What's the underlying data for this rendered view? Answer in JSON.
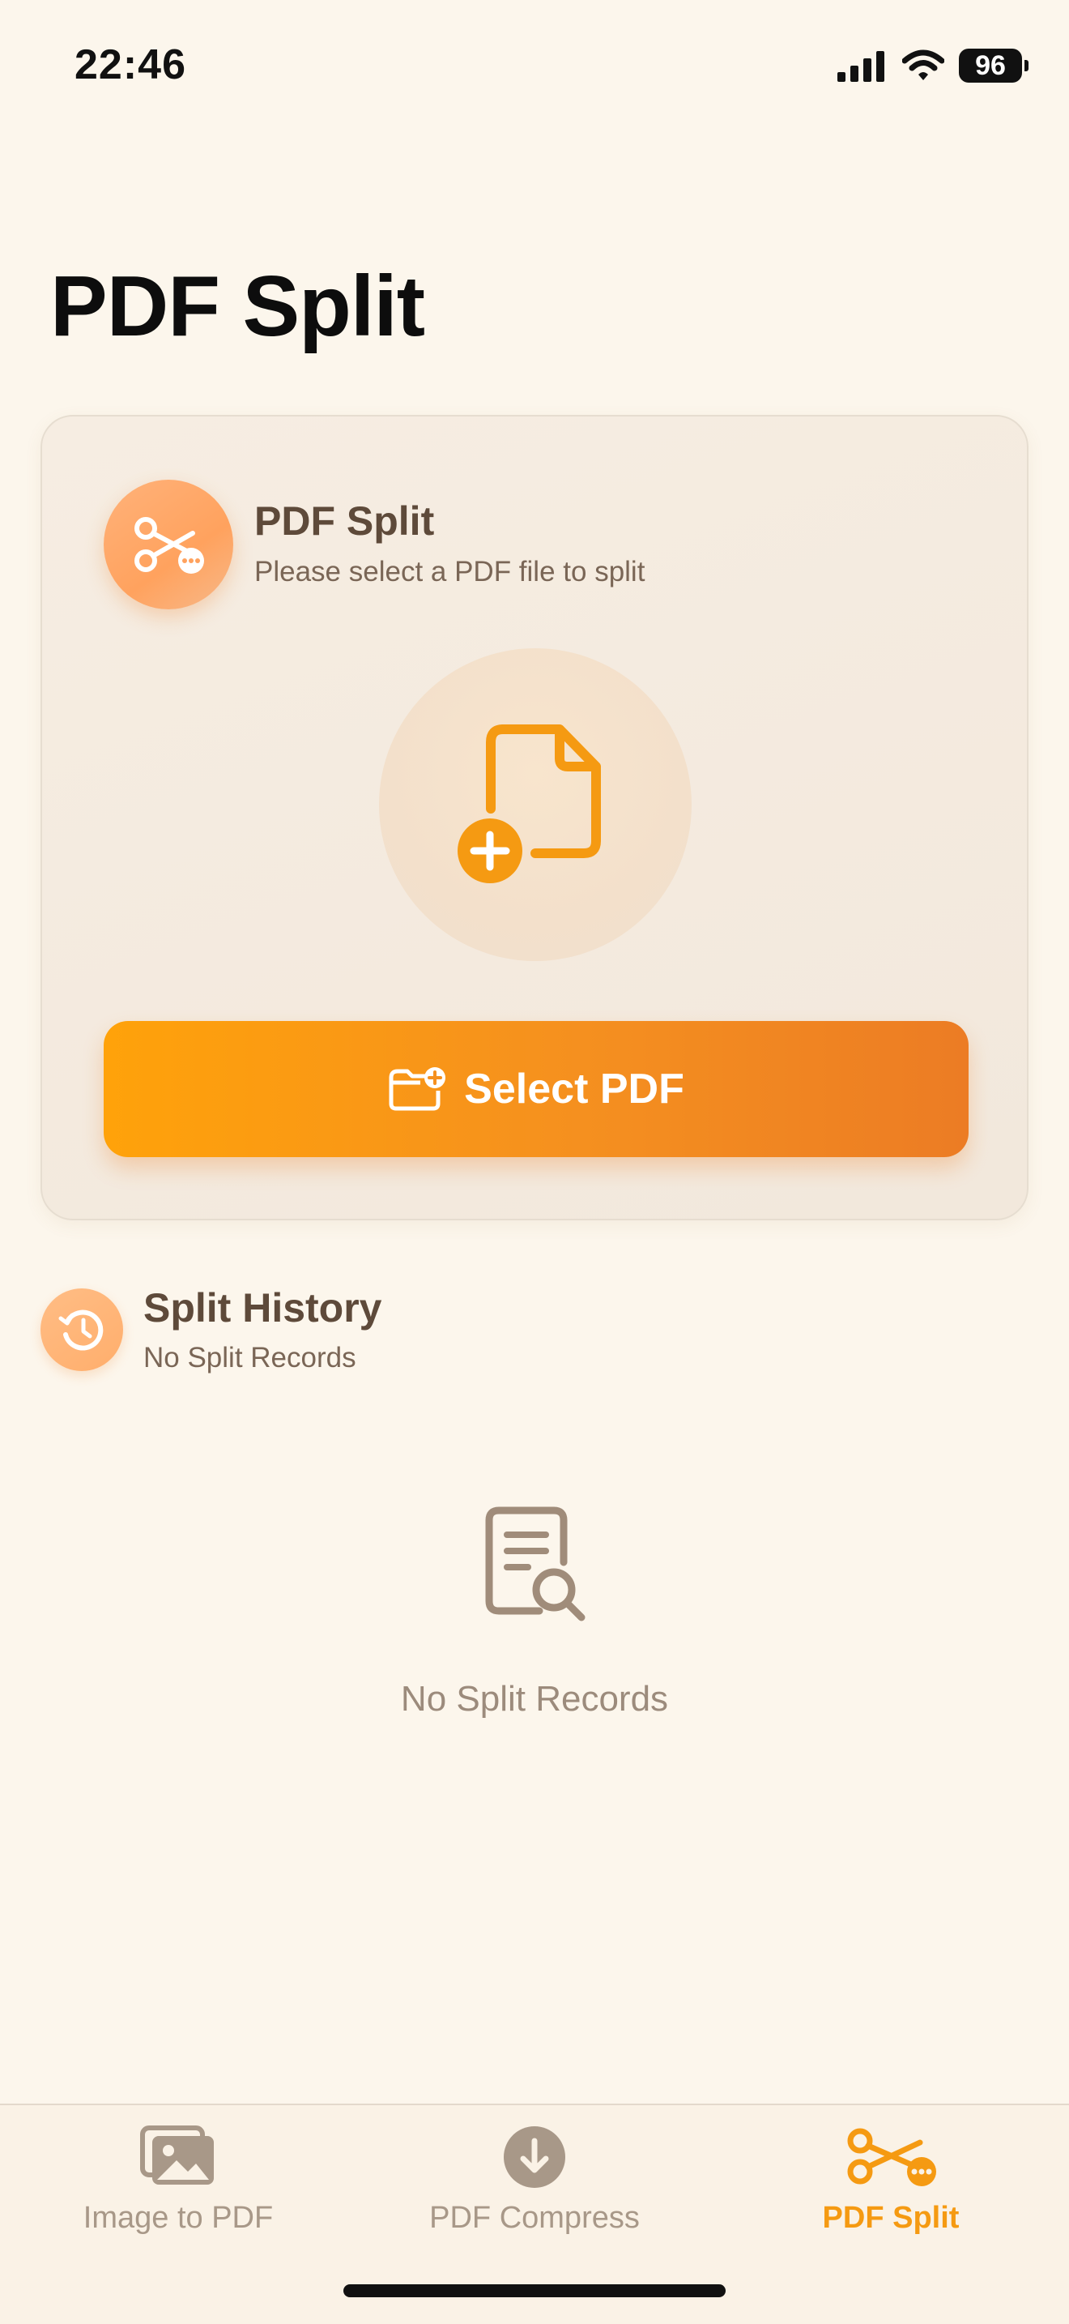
{
  "status_bar": {
    "time": "22:46",
    "battery": "96"
  },
  "page": {
    "title": "PDF Split"
  },
  "card": {
    "title": "PDF Split",
    "subtitle": "Please select a PDF file to split",
    "button_label": "Select PDF",
    "icon": "scissors-icon",
    "drop_icon": "file-add-icon"
  },
  "history": {
    "title": "Split History",
    "subtitle": "No Split Records",
    "empty_text": "No Split Records",
    "icon": "history-icon"
  },
  "tabs": [
    {
      "label": "Image to PDF",
      "icon": "images-icon",
      "active": false
    },
    {
      "label": "PDF Compress",
      "icon": "download-circle-icon",
      "active": false
    },
    {
      "label": "PDF Split",
      "icon": "scissors-icon",
      "active": true
    }
  ],
  "colors": {
    "background": "#fcf6ec",
    "accent": "#f59a12",
    "accent_dark": "#ec7c24",
    "text_brown": "#5e4a3a",
    "muted": "#a89888"
  }
}
